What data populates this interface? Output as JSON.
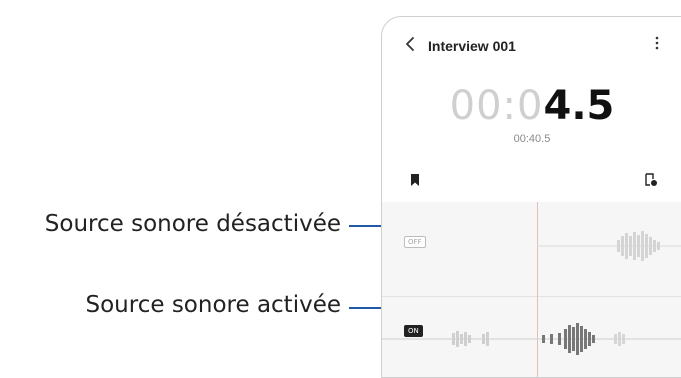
{
  "callouts": {
    "off": "Source sonore désactivée",
    "on": "Source sonore activée"
  },
  "app": {
    "title": "Interview 001",
    "back_icon": "chevron-left-icon",
    "more_icon": "more-vertical-icon"
  },
  "timer": {
    "dim": "00:0",
    "strong": "4.5",
    "total": "00:40.5"
  },
  "tracks": {
    "off_badge": "OFF",
    "on_badge": "ON"
  },
  "icons": {
    "bookmark": "bookmark-icon",
    "add_bookmark": "add-bookmark-icon"
  },
  "colors": {
    "accent_line": "#1f5aa6",
    "playhead": "#f0b9b9"
  }
}
